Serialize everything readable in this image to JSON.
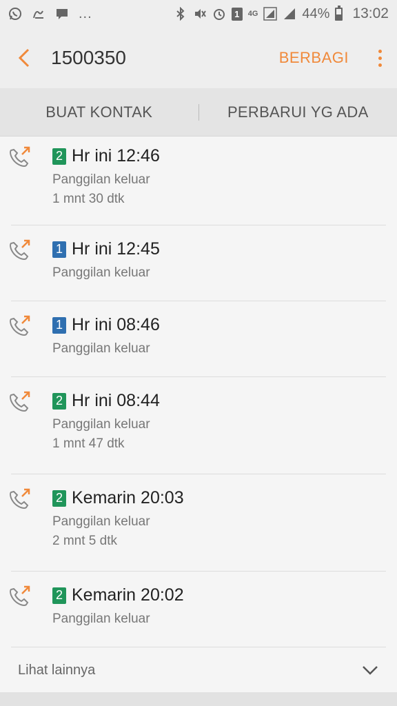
{
  "status_bar": {
    "battery_percent": "44%",
    "time": "13:02",
    "network_label": "4G",
    "sim_indicator": "1",
    "icons_left": [
      "whatsapp-icon",
      "link-icon",
      "message-icon",
      "more-dots"
    ],
    "icons_right": [
      "bluetooth-icon",
      "mute-icon",
      "alarm-icon",
      "sim-icon",
      "4g-signal-icon",
      "signal-icon",
      "battery-icon"
    ],
    "battery_level": 0.44
  },
  "app_bar": {
    "title": "1500350",
    "share_label": "BERBAGI"
  },
  "actions": {
    "create_contact": "BUAT KONTAK",
    "update_existing": "PERBARUI YG ADA"
  },
  "calls": [
    {
      "sim": "2",
      "time": "Hr ini 12:46",
      "type": "Panggilan keluar",
      "duration": "1 mnt 30 dtk"
    },
    {
      "sim": "1",
      "time": "Hr ini 12:45",
      "type": "Panggilan keluar",
      "duration": ""
    },
    {
      "sim": "1",
      "time": "Hr ini 08:46",
      "type": "Panggilan keluar",
      "duration": ""
    },
    {
      "sim": "2",
      "time": "Hr ini 08:44",
      "type": "Panggilan keluar",
      "duration": "1 mnt 47 dtk"
    },
    {
      "sim": "2",
      "time": "Kemarin 20:03",
      "type": "Panggilan keluar",
      "duration": "2 mnt 5 dtk"
    },
    {
      "sim": "2",
      "time": "Kemarin 20:02",
      "type": "Panggilan keluar",
      "duration": ""
    }
  ],
  "see_more_label": "Lihat lainnya",
  "colors": {
    "accent": "#f0893a",
    "sim1": "#2f6fb0",
    "sim2": "#20955a"
  }
}
